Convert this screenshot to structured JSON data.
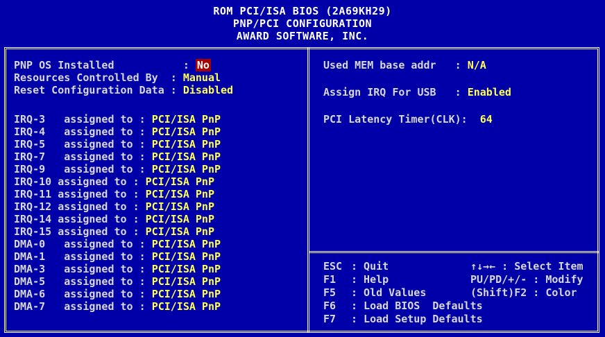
{
  "header": {
    "line1": "ROM PCI/ISA BIOS (2A69KH29)",
    "line2": "PNP/PCI CONFIGURATION",
    "line3": "AWARD SOFTWARE, INC."
  },
  "left": {
    "top_settings": [
      {
        "label": "PNP OS Installed           : ",
        "value": "No"
      },
      {
        "label": "Resources Controlled By  : ",
        "value": "Manual"
      },
      {
        "label": "Reset Configuration Data : ",
        "value": "Disabled"
      }
    ],
    "irq_rows": [
      {
        "label": "IRQ-3   assigned to : ",
        "value": "PCI/ISA PnP"
      },
      {
        "label": "IRQ-4   assigned to : ",
        "value": "PCI/ISA PnP"
      },
      {
        "label": "IRQ-5   assigned to : ",
        "value": "PCI/ISA PnP"
      },
      {
        "label": "IRQ-7   assigned to : ",
        "value": "PCI/ISA PnP"
      },
      {
        "label": "IRQ-9   assigned to : ",
        "value": "PCI/ISA PnP"
      },
      {
        "label": "IRQ-10 assigned to : ",
        "value": "PCI/ISA PnP"
      },
      {
        "label": "IRQ-11 assigned to : ",
        "value": "PCI/ISA PnP"
      },
      {
        "label": "IRQ-12 assigned to : ",
        "value": "PCI/ISA PnP"
      },
      {
        "label": "IRQ-14 assigned to : ",
        "value": "PCI/ISA PnP"
      },
      {
        "label": "IRQ-15 assigned to : ",
        "value": "PCI/ISA PnP"
      },
      {
        "label": "DMA-0   assigned to : ",
        "value": "PCI/ISA PnP"
      },
      {
        "label": "DMA-1   assigned to : ",
        "value": "PCI/ISA PnP"
      },
      {
        "label": "DMA-3   assigned to : ",
        "value": "PCI/ISA PnP"
      },
      {
        "label": "DMA-5   assigned to : ",
        "value": "PCI/ISA PnP"
      },
      {
        "label": "DMA-6   assigned to : ",
        "value": "PCI/ISA PnP"
      },
      {
        "label": "DMA-7   assigned to : ",
        "value": "PCI/ISA PnP"
      }
    ]
  },
  "right": {
    "settings": [
      {
        "label": "Used MEM base addr   : ",
        "value": "N/A"
      },
      {
        "label": "Assign IRQ For USB   : ",
        "value": "Enabled"
      },
      {
        "label": "PCI Latency Timer(CLK):  ",
        "value": "64"
      }
    ]
  },
  "legend": [
    {
      "key": "ESC",
      "action": ": Quit",
      "hint": "↑↓→← : Select Item"
    },
    {
      "key": "F1",
      "action": ": Help",
      "hint": "PU/PD/+/- : Modify"
    },
    {
      "key": "F5",
      "action": ": Old Values",
      "hint": "(Shift)F2 : Color"
    },
    {
      "key": "F6",
      "action": ": Load BIOS  Defaults",
      "hint": ""
    },
    {
      "key": "F7",
      "action": ": Load Setup Defaults",
      "hint": ""
    }
  ],
  "colors": {
    "background": "#0000a8",
    "value": "#ffff54",
    "selection": "#a80000",
    "text": "#d8d8d8"
  }
}
